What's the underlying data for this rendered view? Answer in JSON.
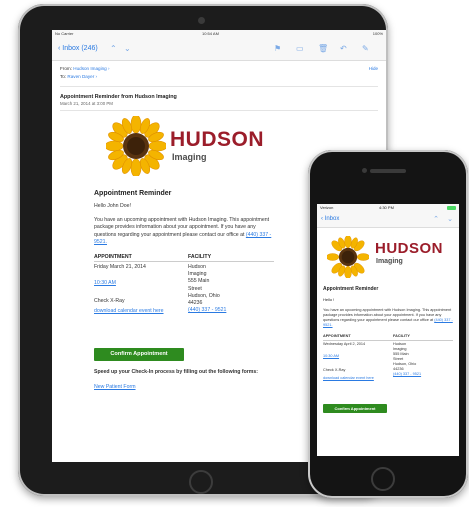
{
  "ipad": {
    "status": {
      "carrier": "No Carrier",
      "time": "10:54 AM",
      "battery": "100%"
    },
    "toolbar": {
      "back_label": "Inbox (246)"
    },
    "header": {
      "from_label": "From:",
      "from_name": "Hudson Imaging",
      "to_label": "To:",
      "to_name": "Raven Dayer",
      "hide_label": "Hide",
      "subject": "Appointment Reminder from Hudson Imaging",
      "date": "March 21, 2014 at 3:00 PM"
    },
    "email": {
      "brand_name": "HUDSON",
      "brand_sub": "Imaging",
      "title": "Appointment Reminder",
      "greeting": "Hello John Doe!",
      "intro": "You have an upcoming appointment with Hudson Imaging. This appointment package provides information about your appointment. If you have any questions regarding your appointment please contact our office at",
      "phone": "(440) 337 - 9521.",
      "col_appointment": "APPOINTMENT",
      "col_facility": "FACILITY",
      "appt_date": "Friday March 21, 2014",
      "appt_time": "10:30 AM",
      "appt_type": "Check X-Ray",
      "download_link": "download calendar event here",
      "facility_lines": [
        "Hudson",
        "Imaging",
        "555 Main",
        "Street",
        "Hudson, Ohio",
        "44236"
      ],
      "facility_phone": "(440) 337 - 9521",
      "confirm_label": "Confirm Appointment",
      "speed_text": "Speed up your Check-In process by filling out the following forms:",
      "form_link": "New Patient Form"
    }
  },
  "iphone": {
    "status": {
      "carrier": "Verizon",
      "time": "4:30 PM"
    },
    "toolbar": {
      "back_label": "Inbox"
    },
    "email": {
      "brand_name": "HUDSON",
      "brand_sub": "Imaging",
      "title": "Appointment Reminder",
      "greeting": "Hello !",
      "intro": "You have an upcoming appointment with Hudson Imaging. This appointment package provides information about your appointment. If you have any questions regarding your appointment please contact our office at",
      "phone": "(440) 337 - 9521.",
      "col_appointment": "APPOINTMENT",
      "col_facility": "FACILITY",
      "appt_date": "Wednesday April 2, 2014",
      "appt_time": "10:30 AM",
      "appt_type": "Check X-Ray",
      "download_link": "download calendar event here",
      "facility_lines": [
        "Hudson",
        "Imaging",
        "555 Main",
        "Street",
        "Hudson, Ohio",
        "44236"
      ],
      "facility_phone": "(440) 337 - 9521",
      "confirm_label": "Confirm Appointment"
    }
  },
  "colors": {
    "brand_red": "#9b1d2a",
    "link_blue": "#2a7ae2",
    "button_green": "#2e8b1f",
    "device_black": "#1c1c1c"
  }
}
